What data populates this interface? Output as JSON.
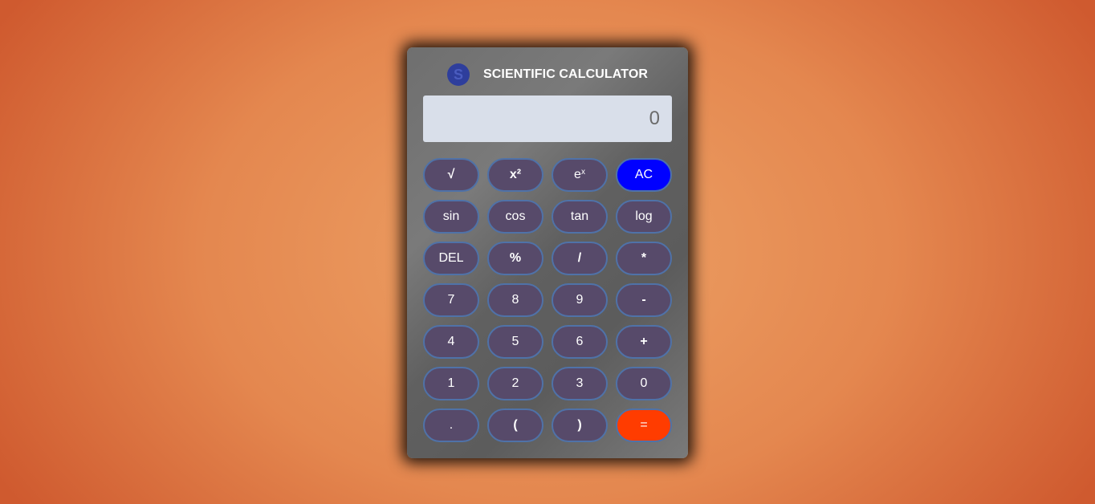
{
  "app": {
    "logo_letter": "S",
    "title": "SCIENTIFIC CALCULATOR"
  },
  "display": {
    "value": "0"
  },
  "keys": {
    "sqrt": "√",
    "square": "x²",
    "exp_base": "e",
    "exp_power": "x",
    "ac": "AC",
    "sin": "sin",
    "cos": "cos",
    "tan": "tan",
    "log": "log",
    "del": "DEL",
    "percent": "%",
    "divide": "/",
    "multiply": "*",
    "seven": "7",
    "eight": "8",
    "nine": "9",
    "minus": "-",
    "four": "4",
    "five": "5",
    "six": "6",
    "plus": "+",
    "one": "1",
    "two": "2",
    "three": "3",
    "zero": "0",
    "dot": ".",
    "open_paren": "(",
    "close_paren": ")",
    "equals": "="
  },
  "colors": {
    "key_bg": "#574a6a",
    "key_border": "#4f72a8",
    "ac_bg": "#0000ff",
    "equals_bg": "#ff3c00",
    "display_bg": "#d9dfea",
    "logo_bg": "#2e3e9c"
  }
}
